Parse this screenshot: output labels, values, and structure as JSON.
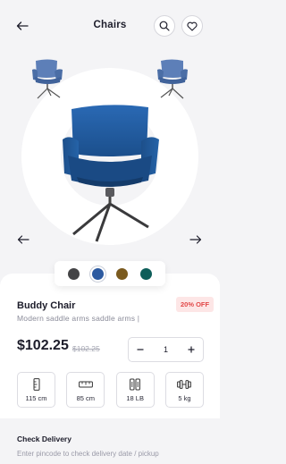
{
  "header": {
    "title": "Chairs",
    "back_icon": "arrow-left-icon",
    "search_icon": "search-icon",
    "favorite_icon": "heart-icon"
  },
  "colors": {
    "background": "#f4f4f6",
    "chair_blue": "#1f5fa8",
    "badge_bg": "#fde6e6",
    "badge_text": "#e24848",
    "text_primary": "#1c1c2a",
    "text_muted": "#8b8c9a"
  },
  "color_options": [
    {
      "name": "charcoal",
      "hex": "#444446",
      "selected": false
    },
    {
      "name": "blue",
      "hex": "#2c5aa0",
      "selected": true
    },
    {
      "name": "bronze",
      "hex": "#7a5a1e",
      "selected": false
    },
    {
      "name": "teal",
      "hex": "#0e5e5a",
      "selected": false
    }
  ],
  "product": {
    "name": "Buddy Chair",
    "description": "Modern saddle arms saddle arms |",
    "discount_badge": "20% OFF",
    "price": "$102.25",
    "old_price": "$102.25",
    "quantity": "1"
  },
  "specs": [
    {
      "icon": "height-icon",
      "label": "115 cm"
    },
    {
      "icon": "width-icon",
      "label": "85 cm"
    },
    {
      "icon": "load-icon",
      "label": "18 LB"
    },
    {
      "icon": "weight-icon",
      "label": "5 kg"
    }
  ],
  "delivery": {
    "title": "Check Delivery",
    "subtitle": "Enter pincode to check delivery date / pickup"
  }
}
